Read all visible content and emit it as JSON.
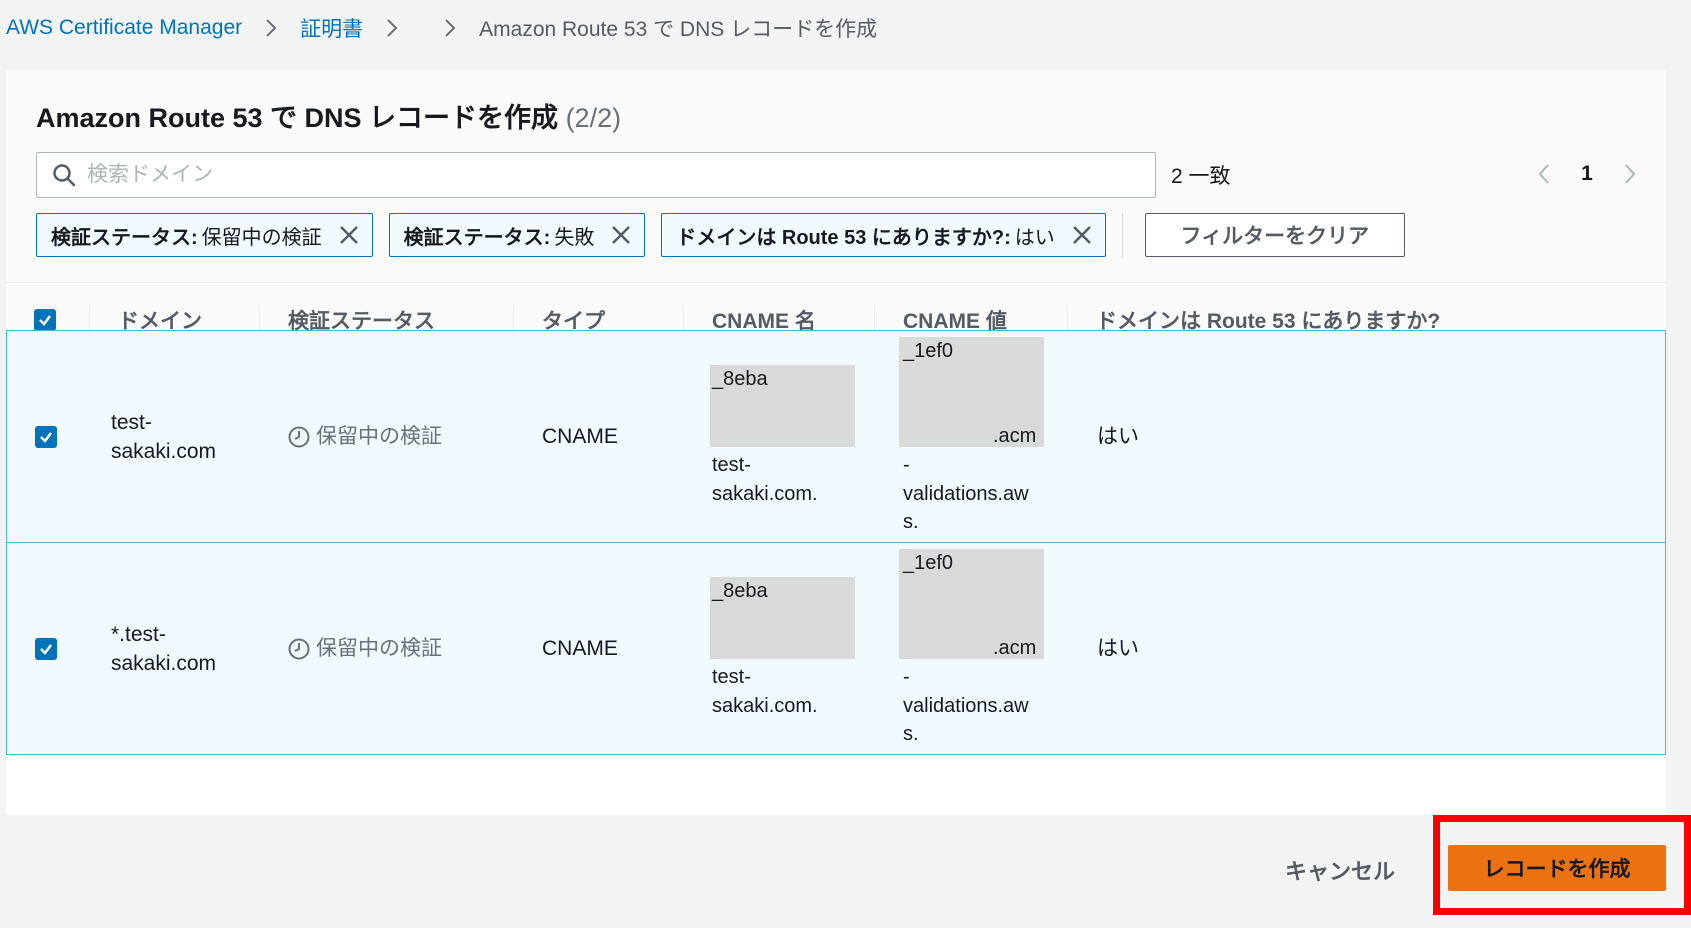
{
  "breadcrumb": {
    "service": "AWS Certificate Manager",
    "certificates": "証明書",
    "current": "Amazon Route 53 で DNS レコードを作成"
  },
  "panel": {
    "title": "Amazon Route 53 で DNS レコードを作成",
    "count": "(2/2)"
  },
  "search": {
    "placeholder": "検索ドメイン",
    "value": "",
    "match_count": "2 一致"
  },
  "pagination": {
    "current_page": "1"
  },
  "filters": [
    {
      "key": "検証ステータス:",
      "value": "保留中の検証"
    },
    {
      "key": "検証ステータス:",
      "value": "失敗"
    },
    {
      "key": "ドメインは Route 53 にありますか?:",
      "value": "はい"
    }
  ],
  "clear_filters_label": "フィルターをクリア",
  "table": {
    "columns": [
      "ドメイン",
      "検証ステータス",
      "タイプ",
      "CNAME 名",
      "CNAME 値",
      "ドメインは Route 53 にありますか?"
    ],
    "rows": [
      {
        "domain_line1": "test-",
        "domain_line2": "sakaki.com",
        "status": "保留中の検証",
        "type": "CNAME",
        "cname_name_prefix": "_8eba",
        "cname_name_suffix1": "test-",
        "cname_name_suffix2": "sakaki.com.",
        "cname_value_prefix": "_1ef0",
        "cname_value_mid": ".acm",
        "cname_value_rest1": "-",
        "cname_value_rest2": "validations.aw",
        "cname_value_rest3": "s.",
        "in_route53": "はい",
        "selected": true
      },
      {
        "domain_line1": "*.test-",
        "domain_line2": "sakaki.com",
        "status": "保留中の検証",
        "type": "CNAME",
        "cname_name_prefix": "_8eba",
        "cname_name_suffix1": "test-",
        "cname_name_suffix2": "sakaki.com.",
        "cname_value_prefix": "_1ef0",
        "cname_value_mid": ".acm",
        "cname_value_rest1": "-",
        "cname_value_rest2": "validations.aw",
        "cname_value_rest3": "s.",
        "in_route53": "はい",
        "selected": true
      }
    ]
  },
  "footer": {
    "cancel_label": "キャンセル",
    "create_label": "レコードを作成"
  },
  "colors": {
    "link": "#0073bb",
    "primary_button": "#ec7211",
    "row_selected_bg": "#f1faff",
    "row_selected_border": "#44b9d6",
    "highlight_box": "#ff0000",
    "redaction": "#d9d9d9"
  }
}
